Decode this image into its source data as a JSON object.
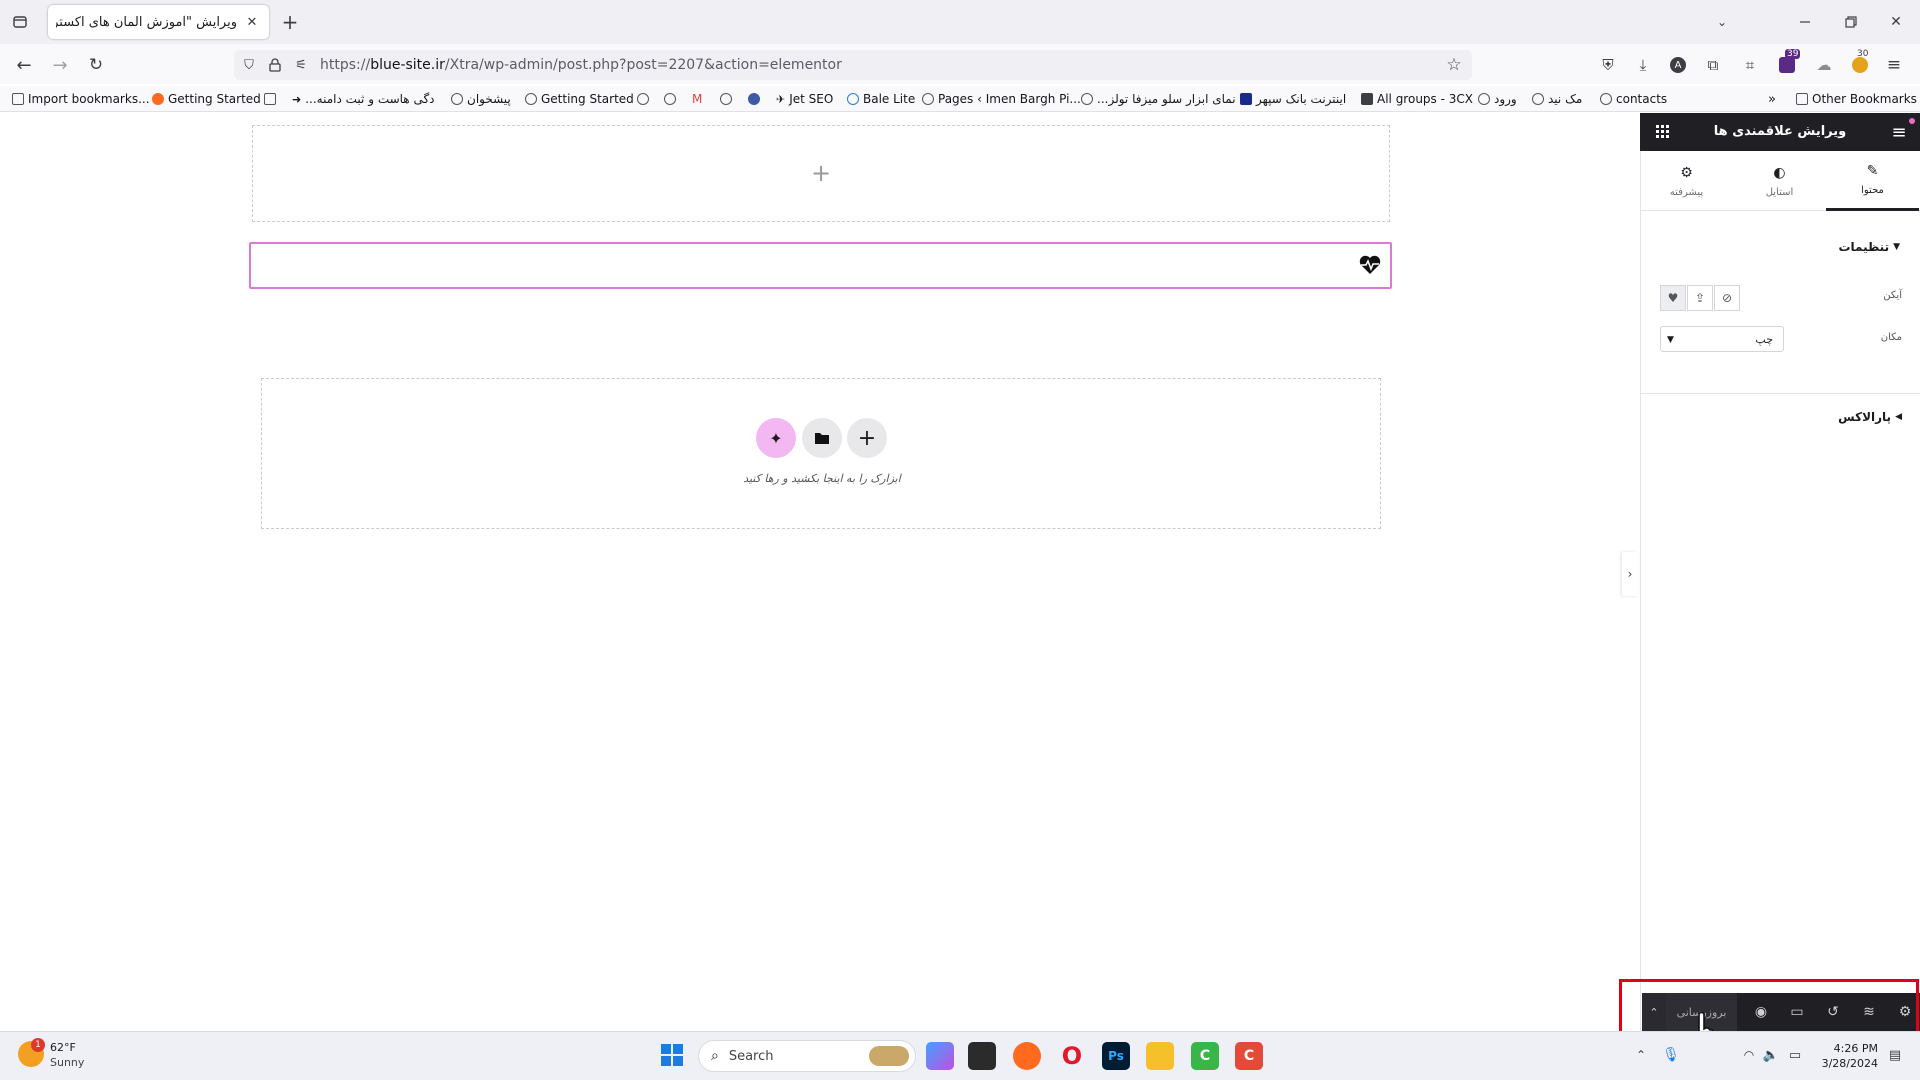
{
  "browser": {
    "tab_title": "ویرایش \"آموزش المان های اکسترا – ما",
    "url_prefix": "https://",
    "url_domain": "blue-site.ir",
    "url_path": "/Xtra/wp-admin/post.php?post=2207&action=elementor",
    "ext_badge": "39",
    "ext_badge2": "30",
    "bookmarks": [
      "Import bookmarks...",
      "Getting Started",
      "...دگی هاست و ثبت دامنه",
      "پیشخوان",
      "Getting Started",
      "Jet SEO",
      "Bale Lite",
      "Pages ‹ Imen Bargh Pi...",
      "...نمای ابزار سلو میزفا تولز",
      "اینترنت بانک سپهر",
      "All groups - 3CX",
      "ورود",
      "مک نید",
      "contacts"
    ],
    "other_bookmarks": "Other Bookmarks"
  },
  "canvas": {
    "add_section_symbol": "+",
    "drop_text": "ابزارک را به اینجا بکشید و رها کنید"
  },
  "panel": {
    "title": "ویرایش علاقمندی ها",
    "tabs": [
      {
        "label": "محتوا",
        "icon": "pencil-icon"
      },
      {
        "label": "استایل",
        "icon": "contrast-icon"
      },
      {
        "label": "پیشرفته",
        "icon": "gear-icon"
      }
    ],
    "section_settings": "تنظیمات",
    "icon_label": "آیکن",
    "position_label": "مکان",
    "position_value": "چپ",
    "section_parallax": "پارالاکس"
  },
  "bottom_bar": {
    "update_label": "بروزرسانی"
  },
  "taskbar": {
    "temperature": "62°F",
    "weather": "Sunny",
    "weather_badge": "1",
    "search_placeholder": "Search",
    "time": "4:26 PM",
    "date": "3/28/2024"
  },
  "colors": {
    "accent": "#d97bd6",
    "panel_dark": "#1f1f24",
    "highlight_frame": "#e0001a"
  }
}
